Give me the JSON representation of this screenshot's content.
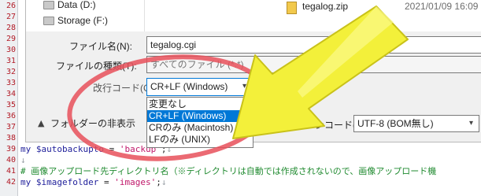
{
  "gutter": {
    "numbers": [
      "26",
      "27",
      "28",
      "29",
      "30",
      "31",
      "32",
      "33",
      "34",
      "35",
      "36",
      "37",
      "38",
      "39",
      "40",
      "41",
      "42"
    ]
  },
  "editor": {
    "line1": {
      "var": "my $autobackupto",
      "op": " = ",
      "str": "'backup'",
      "end": ";"
    },
    "line2": {
      "comment": "# 画像アップロード先ディレクトリ名（※ディレクトリは自動では作成されないので、画像アップロード機"
    },
    "line3": {
      "var": "my $imagefolder",
      "op": " = ",
      "str": "'images'",
      "end": ";"
    },
    "return_mark": "↓"
  },
  "dialog": {
    "nav": {
      "item_data": "Data (D:)",
      "item_storage": "Storage (F:)"
    },
    "file_list": {
      "file_name": "tegalog.zip",
      "file_date": "2021/01/09 16:09"
    },
    "filename_label": "ファイル名(N):",
    "filename_value": "tegalog.cgi",
    "filetype_label": "ファイルの種類(T):",
    "filetype_value": "すべてのファイル (*.*)",
    "linebreak_label": "改行コード(C)",
    "linebreak_selected": "CR+LF (Windows)",
    "linebreak_options": [
      "変更なし",
      "CR+LF (Windows)",
      "CRのみ (Macintosh)",
      "LFのみ (UNIX)"
    ],
    "hide_folders_label": "フォルダーの非表示",
    "encoding_label": "エンコード(E):",
    "encoding_value": "UTF-8 (BOM無し)"
  },
  "colors": {
    "highlight_circle": "#e8505b",
    "arrow_fill": "#f3f03a",
    "selection": "#0078d7"
  }
}
